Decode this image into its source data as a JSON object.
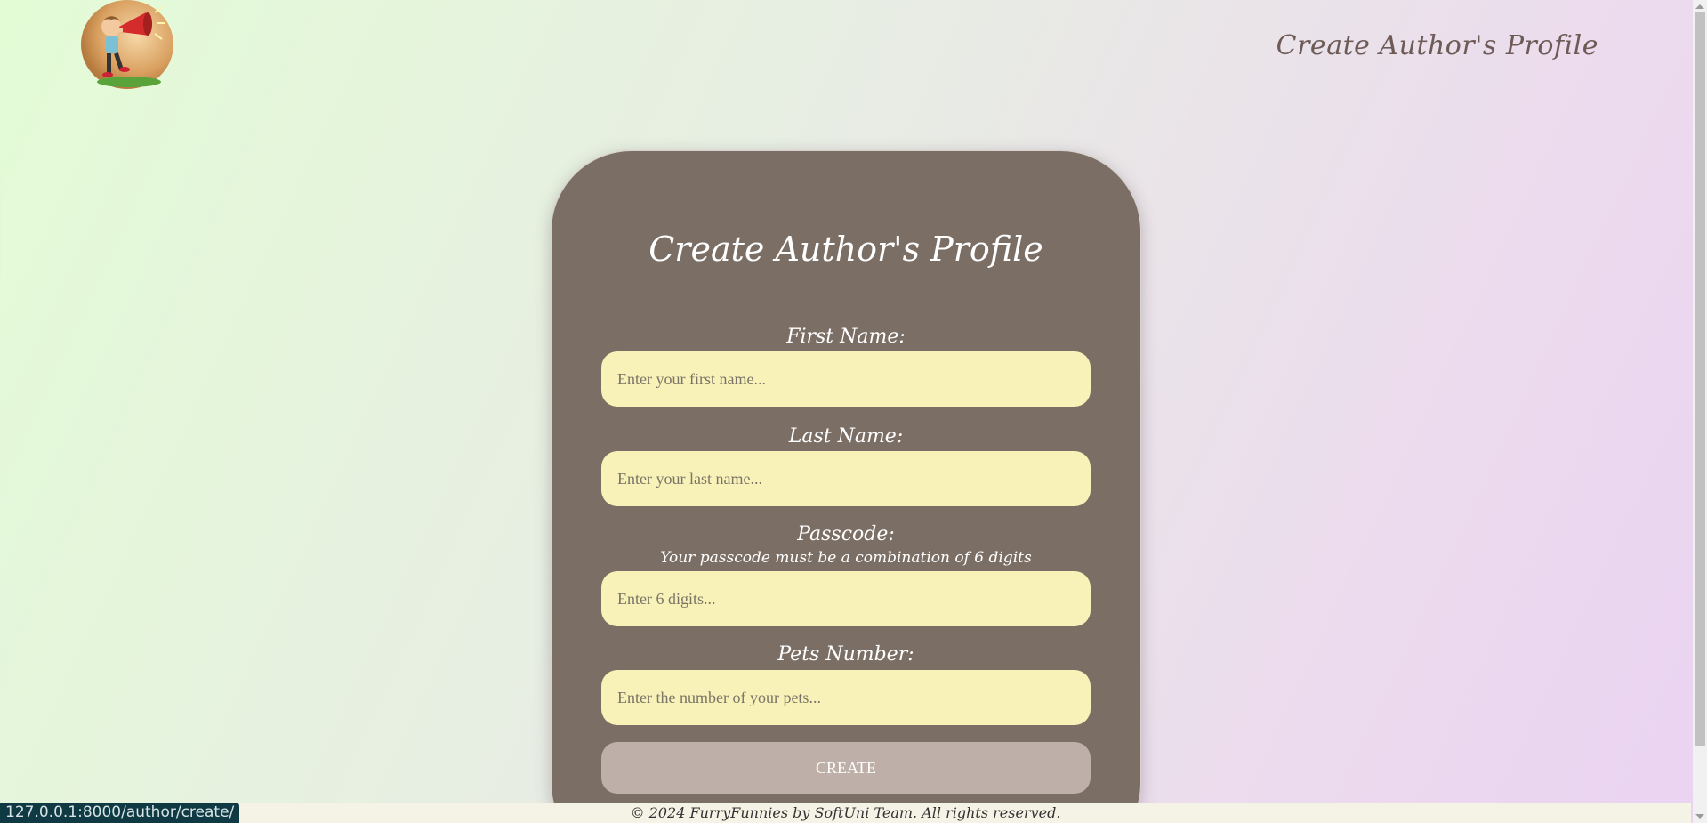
{
  "header": {
    "logo_icon": "megaphone-kid-logo",
    "title": "Create Author's Profile"
  },
  "form": {
    "title": "Create Author's Profile",
    "fields": [
      {
        "label": "First Name:",
        "placeholder": "Enter your first name...",
        "value": ""
      },
      {
        "label": "Last Name:",
        "placeholder": "Enter your last name...",
        "value": ""
      },
      {
        "label": "Passcode:",
        "hint": "Your passcode must be a combination of 6 digits",
        "placeholder": "Enter 6 digits...",
        "value": ""
      },
      {
        "label": "Pets Number:",
        "placeholder": "Enter the number of your pets...",
        "value": ""
      }
    ],
    "submit_label": "CREATE"
  },
  "footer": {
    "text": "© 2024 FurryFunnies by SoftUni Team. All rights reserved."
  },
  "status_bar": {
    "url": "127.0.0.1:8000/author/create/"
  },
  "colors": {
    "card": "#7b6e65",
    "input_bg": "#f8f2b8",
    "button_bg": "#beb0a8",
    "header_title": "#6e5b58"
  }
}
